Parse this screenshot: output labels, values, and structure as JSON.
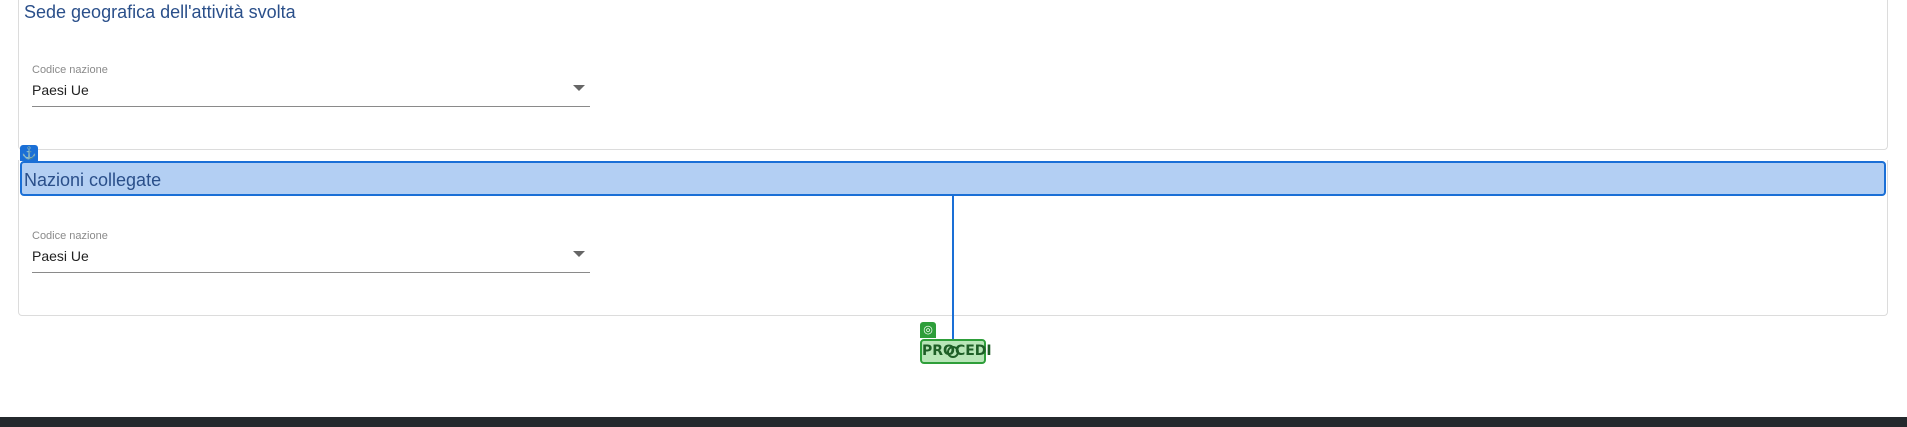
{
  "sections": [
    {
      "title": "Sede geografica dell'attività svolta",
      "field": {
        "label": "Codice nazione",
        "value": "Paesi Ue"
      }
    },
    {
      "title": "Nazioni collegate",
      "field": {
        "label": "Codice nazione",
        "value": "Paesi Ue"
      }
    }
  ],
  "proceed_label": "PROCEDI",
  "icons": {
    "anchor": "anchor-icon",
    "target": "target-icon",
    "move": "move-icon",
    "dropdown": "chevron-down-icon"
  },
  "colors": {
    "title": "#2a4f8a",
    "highlight_fill": "#b3cff3",
    "highlight_border": "#1a6fd6",
    "proceed_fill": "#b8e6b8",
    "proceed_border": "#2e9e3a"
  }
}
